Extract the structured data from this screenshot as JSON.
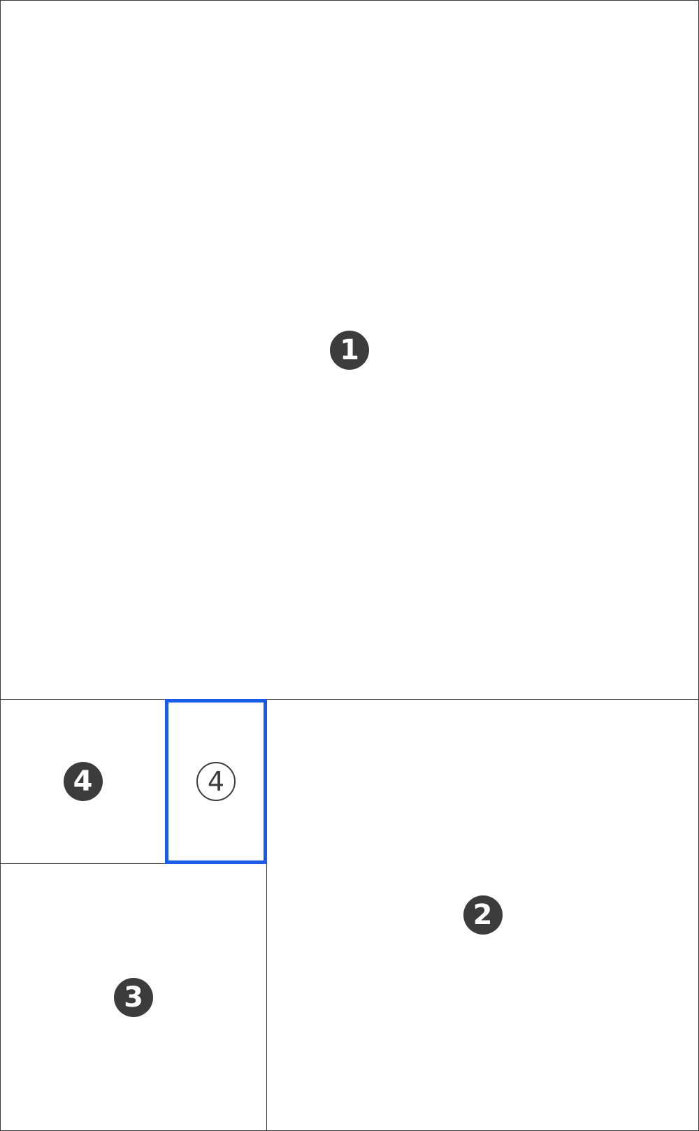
{
  "panels": [
    {
      "id": "1",
      "label": "1",
      "style": "filled",
      "selected": false
    },
    {
      "id": "4a",
      "label": "4",
      "style": "filled",
      "selected": false
    },
    {
      "id": "4b",
      "label": "4",
      "style": "outline",
      "selected": true
    },
    {
      "id": "3",
      "label": "3",
      "style": "filled",
      "selected": false
    },
    {
      "id": "2",
      "label": "2",
      "style": "filled",
      "selected": false
    }
  ],
  "colors": {
    "border": "#3c3c3c",
    "badge_fill": "#3c3c3c",
    "selection": "#1a5ce6",
    "background": "#ffffff"
  }
}
